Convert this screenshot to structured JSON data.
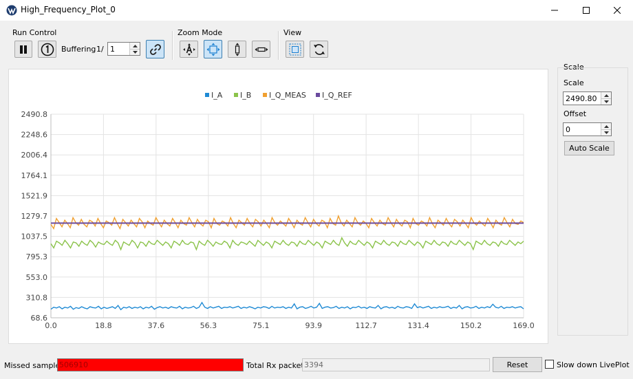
{
  "window": {
    "title": "High_Frequency_Plot_0"
  },
  "toolbar": {
    "run_control": {
      "label": "Run Control",
      "buffering_label": "Buffering",
      "buffering_prefix": "1/",
      "buffering_value": "1"
    },
    "zoom_mode": {
      "label": "Zoom Mode"
    },
    "view": {
      "label": "View"
    }
  },
  "scale_panel": {
    "title": "Scale",
    "scale_label": "Scale",
    "scale_value": "2490.80",
    "offset_label": "Offset",
    "offset_value": "0",
    "auto_scale_label": "Auto Scale"
  },
  "status": {
    "missed_label": "Missed samples",
    "missed_value": "506910",
    "missed_color": "#ff0000",
    "rx_label": "Total Rx packets",
    "rx_value": "3394",
    "reset_label": "Reset",
    "slow_label": "Slow down LivePlot"
  },
  "chart_data": {
    "type": "line",
    "title": "",
    "xlabel": "",
    "ylabel": "",
    "xlim": [
      0.0,
      169.0
    ],
    "ylim": [
      68.6,
      2490.8
    ],
    "x_ticks": [
      "0.0",
      "18.8",
      "37.6",
      "56.3",
      "75.1",
      "93.9",
      "112.7",
      "131.4",
      "150.2",
      "169.0"
    ],
    "y_ticks": [
      "68.6",
      "310.8",
      "553.0",
      "795.3",
      "1037.5",
      "1279.7",
      "1521.9",
      "1764.1",
      "2006.4",
      "2248.6",
      "2490.8"
    ],
    "grid": true,
    "legend_position": "top-center",
    "series": [
      {
        "name": "I_A",
        "color": "#1f8ad4",
        "values": [
          170,
          195,
          185,
          200,
          175,
          195,
          185,
          205,
          170,
          190,
          180,
          200,
          185,
          175,
          200,
          190,
          185,
          205,
          175,
          195,
          180,
          190,
          200,
          180,
          215,
          165,
          195,
          185,
          200,
          180,
          195,
          185,
          200,
          175,
          195,
          185,
          205,
          170,
          190,
          200,
          185,
          195,
          180,
          200,
          190,
          185,
          205,
          175,
          195,
          185,
          190,
          205,
          180,
          195,
          250,
          195,
          180,
          200,
          185,
          195,
          205,
          180,
          195,
          190,
          200,
          185,
          195,
          205,
          180,
          195,
          185,
          200,
          190,
          175,
          195,
          185,
          200,
          195,
          180,
          205,
          185,
          195,
          190,
          200,
          180,
          195,
          185,
          235,
          175,
          195,
          200,
          180,
          190,
          205,
          185,
          195,
          240,
          180,
          195,
          200,
          185,
          190,
          205,
          180,
          195,
          185,
          200,
          175,
          195,
          190,
          205,
          185,
          195,
          180,
          200,
          190,
          185,
          215,
          175,
          195,
          200,
          185,
          195,
          180,
          205,
          190,
          185,
          200,
          195,
          180,
          235,
          190,
          200,
          185,
          195,
          205,
          180,
          195,
          185,
          200,
          190,
          195,
          205,
          180,
          195,
          185,
          215,
          175,
          195,
          200,
          185,
          190,
          205,
          180,
          195,
          185,
          200,
          190,
          230,
          195,
          185,
          205,
          180,
          195,
          190,
          200,
          185,
          195,
          200,
          175
        ]
      },
      {
        "name": "I_B",
        "color": "#8bc34a",
        "values": [
          950,
          900,
          980,
          960,
          930,
          990,
          950,
          900,
          970,
          960,
          920,
          980,
          950,
          930,
          990,
          960,
          910,
          970,
          950,
          940,
          980,
          950,
          930,
          990,
          960,
          880,
          970,
          950,
          930,
          990,
          960,
          900,
          970,
          960,
          920,
          980,
          950,
          940,
          990,
          960,
          930,
          970,
          950,
          900,
          980,
          960,
          930,
          990,
          950,
          940,
          970,
          960,
          880,
          980,
          950,
          930,
          990,
          960,
          920,
          970,
          950,
          940,
          980,
          960,
          900,
          990,
          950,
          930,
          970,
          960,
          940,
          980,
          950,
          920,
          990,
          960,
          930,
          970,
          950,
          900,
          980,
          960,
          940,
          990,
          950,
          930,
          970,
          960,
          920,
          980,
          950,
          940,
          990,
          960,
          930,
          970,
          950,
          900,
          980,
          960,
          940,
          990,
          950,
          930,
          1020,
          960,
          920,
          980,
          950,
          940,
          990,
          960,
          930,
          970,
          950,
          900,
          980,
          960,
          940,
          990,
          950,
          930,
          970,
          960,
          920,
          980,
          950,
          940,
          990,
          960,
          930,
          970,
          950,
          900,
          980,
          960,
          940,
          990,
          950,
          930,
          970,
          960,
          920,
          980,
          950,
          940,
          990,
          960,
          930,
          970,
          950,
          880,
          980,
          960,
          940,
          990,
          950,
          930,
          970,
          960,
          920,
          980,
          950,
          940,
          990,
          960,
          930,
          970,
          950,
          980
        ]
      },
      {
        "name": "I_Q_MEAS",
        "color": "#f0a030",
        "values": [
          1180,
          1130,
          1250,
          1200,
          1150,
          1230,
          1190,
          1140,
          1260,
          1200,
          1170,
          1240,
          1180,
          1150,
          1230,
          1210,
          1160,
          1250,
          1190,
          1140,
          1220,
          1200,
          1170,
          1260,
          1190,
          1130,
          1240,
          1200,
          1160,
          1230,
          1190,
          1150,
          1250,
          1210,
          1140,
          1220,
          1190,
          1170,
          1260,
          1200,
          1150,
          1230,
          1190,
          1160,
          1250,
          1200,
          1140,
          1230,
          1190,
          1170,
          1260,
          1200,
          1150,
          1240,
          1190,
          1160,
          1230,
          1210,
          1140,
          1250,
          1190,
          1170,
          1220,
          1200,
          1160,
          1260,
          1190,
          1140,
          1230,
          1200,
          1170,
          1250,
          1190,
          1150,
          1240,
          1210,
          1160,
          1230,
          1190,
          1140,
          1260,
          1200,
          1170,
          1220,
          1190,
          1160,
          1250,
          1200,
          1140,
          1230,
          1190,
          1170,
          1260,
          1200,
          1150,
          1240,
          1190,
          1160,
          1230,
          1210,
          1140,
          1250,
          1190,
          1170,
          1280,
          1200,
          1160,
          1230,
          1190,
          1150,
          1260,
          1200,
          1170,
          1220,
          1190,
          1140,
          1250,
          1200,
          1160,
          1230,
          1190,
          1170,
          1260,
          1200,
          1150,
          1240,
          1190,
          1160,
          1230,
          1210,
          1140,
          1250,
          1190,
          1170,
          1220,
          1200,
          1160,
          1260,
          1190,
          1140,
          1230,
          1200,
          1170,
          1250,
          1190,
          1150,
          1240,
          1210,
          1160,
          1230,
          1190,
          1140,
          1260,
          1200,
          1170,
          1220,
          1190,
          1160,
          1250,
          1200,
          1140,
          1230,
          1190,
          1170,
          1260,
          1200,
          1150,
          1240,
          1190,
          1180,
          1220,
          1200
        ]
      },
      {
        "name": "I_Q_REF",
        "color": "#6a4a9e",
        "values": [
          1195,
          1195,
          1195,
          1195,
          1195,
          1195,
          1195,
          1195,
          1195,
          1195,
          1195,
          1195,
          1195,
          1195,
          1195,
          1195,
          1195,
          1195,
          1195,
          1195,
          1195,
          1195,
          1195,
          1195,
          1195,
          1195,
          1195,
          1195,
          1195,
          1195,
          1195,
          1195,
          1195,
          1195,
          1195,
          1195,
          1195,
          1195,
          1195,
          1195,
          1195,
          1195,
          1195,
          1195,
          1195,
          1195,
          1195,
          1195,
          1195,
          1195,
          1195,
          1195,
          1195,
          1195,
          1195,
          1195,
          1195,
          1195,
          1195,
          1195,
          1195,
          1195,
          1195,
          1195,
          1195,
          1195,
          1195,
          1195,
          1195,
          1195,
          1195,
          1195,
          1195,
          1195,
          1195,
          1195,
          1195,
          1195,
          1195,
          1195,
          1195,
          1195,
          1195,
          1195,
          1195,
          1195,
          1195,
          1195,
          1195,
          1195,
          1195,
          1195,
          1195,
          1195,
          1195,
          1195,
          1195,
          1195,
          1195,
          1195,
          1195,
          1195,
          1195,
          1195,
          1195,
          1195,
          1195,
          1195,
          1195,
          1195,
          1195,
          1195,
          1195,
          1195,
          1195,
          1195,
          1195,
          1195,
          1195,
          1195,
          1195,
          1195,
          1195,
          1195,
          1195,
          1195,
          1195,
          1195,
          1195,
          1195,
          1195,
          1195,
          1195,
          1195,
          1195,
          1195,
          1195,
          1195,
          1195,
          1195,
          1195,
          1195,
          1195,
          1195,
          1195,
          1195,
          1195,
          1195,
          1195,
          1195,
          1195,
          1195,
          1195,
          1195,
          1195,
          1195,
          1195,
          1195,
          1195,
          1195,
          1195,
          1195,
          1195,
          1195,
          1195,
          1195,
          1195,
          1195,
          1195,
          1195
        ]
      }
    ]
  }
}
